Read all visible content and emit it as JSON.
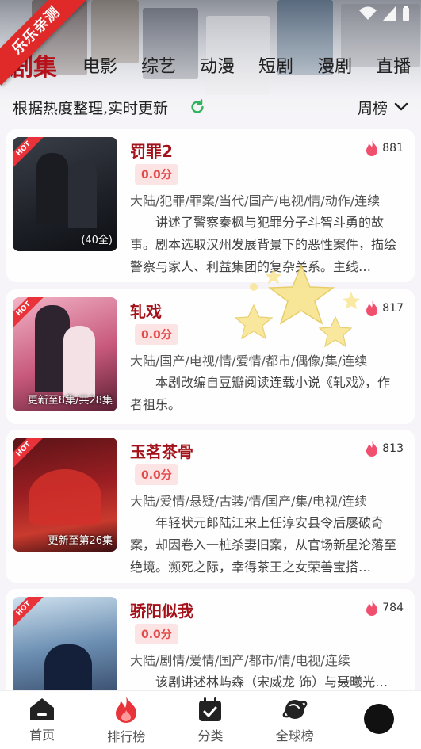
{
  "badge": "乐乐亲测",
  "tabs": [
    {
      "label": "剧集",
      "active": true
    },
    {
      "label": "电影"
    },
    {
      "label": "综艺"
    },
    {
      "label": "动漫"
    },
    {
      "label": "短剧"
    },
    {
      "label": "漫剧"
    },
    {
      "label": "直播"
    }
  ],
  "subbar": {
    "description": "根据热度整理,实时更新",
    "period": "周榜"
  },
  "items": [
    {
      "title": "罚罪2",
      "score": "0.0分",
      "heat": "881",
      "episodes": "(40全)",
      "tags": "大陆/犯罪/罪案/当代/国产/电视/情/动作/连续",
      "intro": "讲述了警察秦枫与犯罪分子斗智斗勇的故事。剧本选取汉州发展背景下的恶性案件，描绘警察与家人、利益集团的复杂关系。主线…"
    },
    {
      "title": "轧戏",
      "score": "0.0分",
      "heat": "817",
      "episodes": "更新至8集/共28集",
      "tags": "大陆/国产/电视/情/爱情/都市/偶像/集/连续",
      "intro": "本剧改编自豆瓣阅读连载小说《轧戏》，作者祖乐。"
    },
    {
      "title": "玉茗茶骨",
      "score": "0.0分",
      "heat": "813",
      "episodes": "更新至第26集",
      "tags": "大陆/爱情/悬疑/古装/情/国产/集/电视/连续",
      "intro": "年轻状元郎陆江来上任淳安县令后屡破奇案，却因卷入一桩杀妻旧案，从官场新星沦落至绝境。濒死之际，幸得茶王之女荣善宝搭…"
    },
    {
      "title": "骄阳似我",
      "score": "0.0分",
      "heat": "784",
      "episodes": "",
      "tags": "大陆/剧情/爱情/国产/都市/情/电视/连续",
      "intro": "该剧讲述林屿森（宋威龙 饰）与聂曦光（赵"
    }
  ],
  "hot_label": "HOT",
  "nav": [
    {
      "label": "首页",
      "icon": "home-icon"
    },
    {
      "label": "排行榜",
      "icon": "flame-icon"
    },
    {
      "label": "分类",
      "icon": "calendar-check-icon"
    },
    {
      "label": "全球榜",
      "icon": "planet-icon"
    },
    {
      "label": "",
      "icon": "avatar"
    }
  ],
  "colors": {
    "accent": "#b5121b",
    "hot": "#e8333a",
    "refresh": "#2fb35a"
  }
}
